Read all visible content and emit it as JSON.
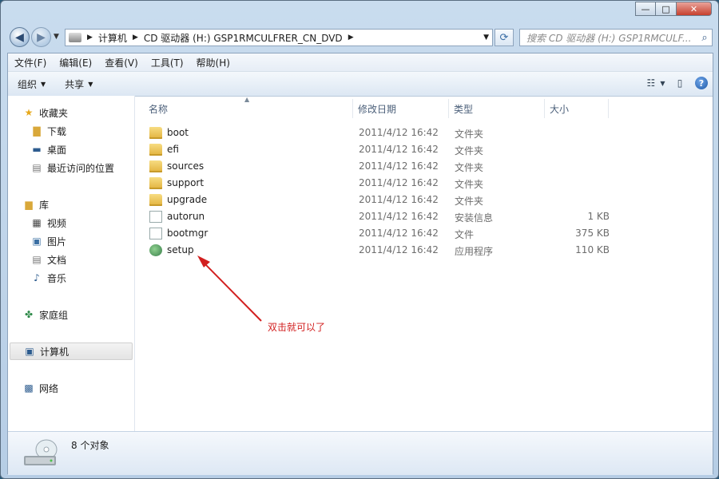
{
  "window": {
    "controls": {
      "min": "—",
      "max": "□",
      "close": "✕"
    }
  },
  "address": {
    "crumbs": [
      "计算机",
      "CD 驱动器 (H:) GSP1RMCULFRER_CN_DVD"
    ],
    "search_placeholder": "搜索 CD 驱动器 (H:) GSP1RMCULF..."
  },
  "menu": [
    "文件(F)",
    "编辑(E)",
    "查看(V)",
    "工具(T)",
    "帮助(H)"
  ],
  "commands": {
    "organize": "组织",
    "share": "共享"
  },
  "nav": {
    "favorites": "收藏夹",
    "downloads": "下载",
    "desktop": "桌面",
    "recent": "最近访问的位置",
    "libraries": "库",
    "videos": "视频",
    "pictures": "图片",
    "documents": "文档",
    "music": "音乐",
    "homegroup": "家庭组",
    "computer": "计算机",
    "network": "网络"
  },
  "columns": {
    "name": "名称",
    "date": "修改日期",
    "type": "类型",
    "size": "大小"
  },
  "files": [
    {
      "name": "boot",
      "date": "2011/4/12 16:42",
      "type": "文件夹",
      "size": "",
      "icon": "folder-icon"
    },
    {
      "name": "efi",
      "date": "2011/4/12 16:42",
      "type": "文件夹",
      "size": "",
      "icon": "folder-icon"
    },
    {
      "name": "sources",
      "date": "2011/4/12 16:42",
      "type": "文件夹",
      "size": "",
      "icon": "folder-icon"
    },
    {
      "name": "support",
      "date": "2011/4/12 16:42",
      "type": "文件夹",
      "size": "",
      "icon": "folder-icon"
    },
    {
      "name": "upgrade",
      "date": "2011/4/12 16:42",
      "type": "文件夹",
      "size": "",
      "icon": "folder-icon"
    },
    {
      "name": "autorun",
      "date": "2011/4/12 16:42",
      "type": "安装信息",
      "size": "1 KB",
      "icon": "setup-info-icon"
    },
    {
      "name": "bootmgr",
      "date": "2011/4/12 16:42",
      "type": "文件",
      "size": "375 KB",
      "icon": "file-icon"
    },
    {
      "name": "setup",
      "date": "2011/4/12 16:42",
      "type": "应用程序",
      "size": "110 KB",
      "icon": "setup-app-icon"
    }
  ],
  "annotation": {
    "text": "双击就可以了",
    "color": "#d21f1f"
  },
  "status": {
    "count": "8 个对象"
  }
}
